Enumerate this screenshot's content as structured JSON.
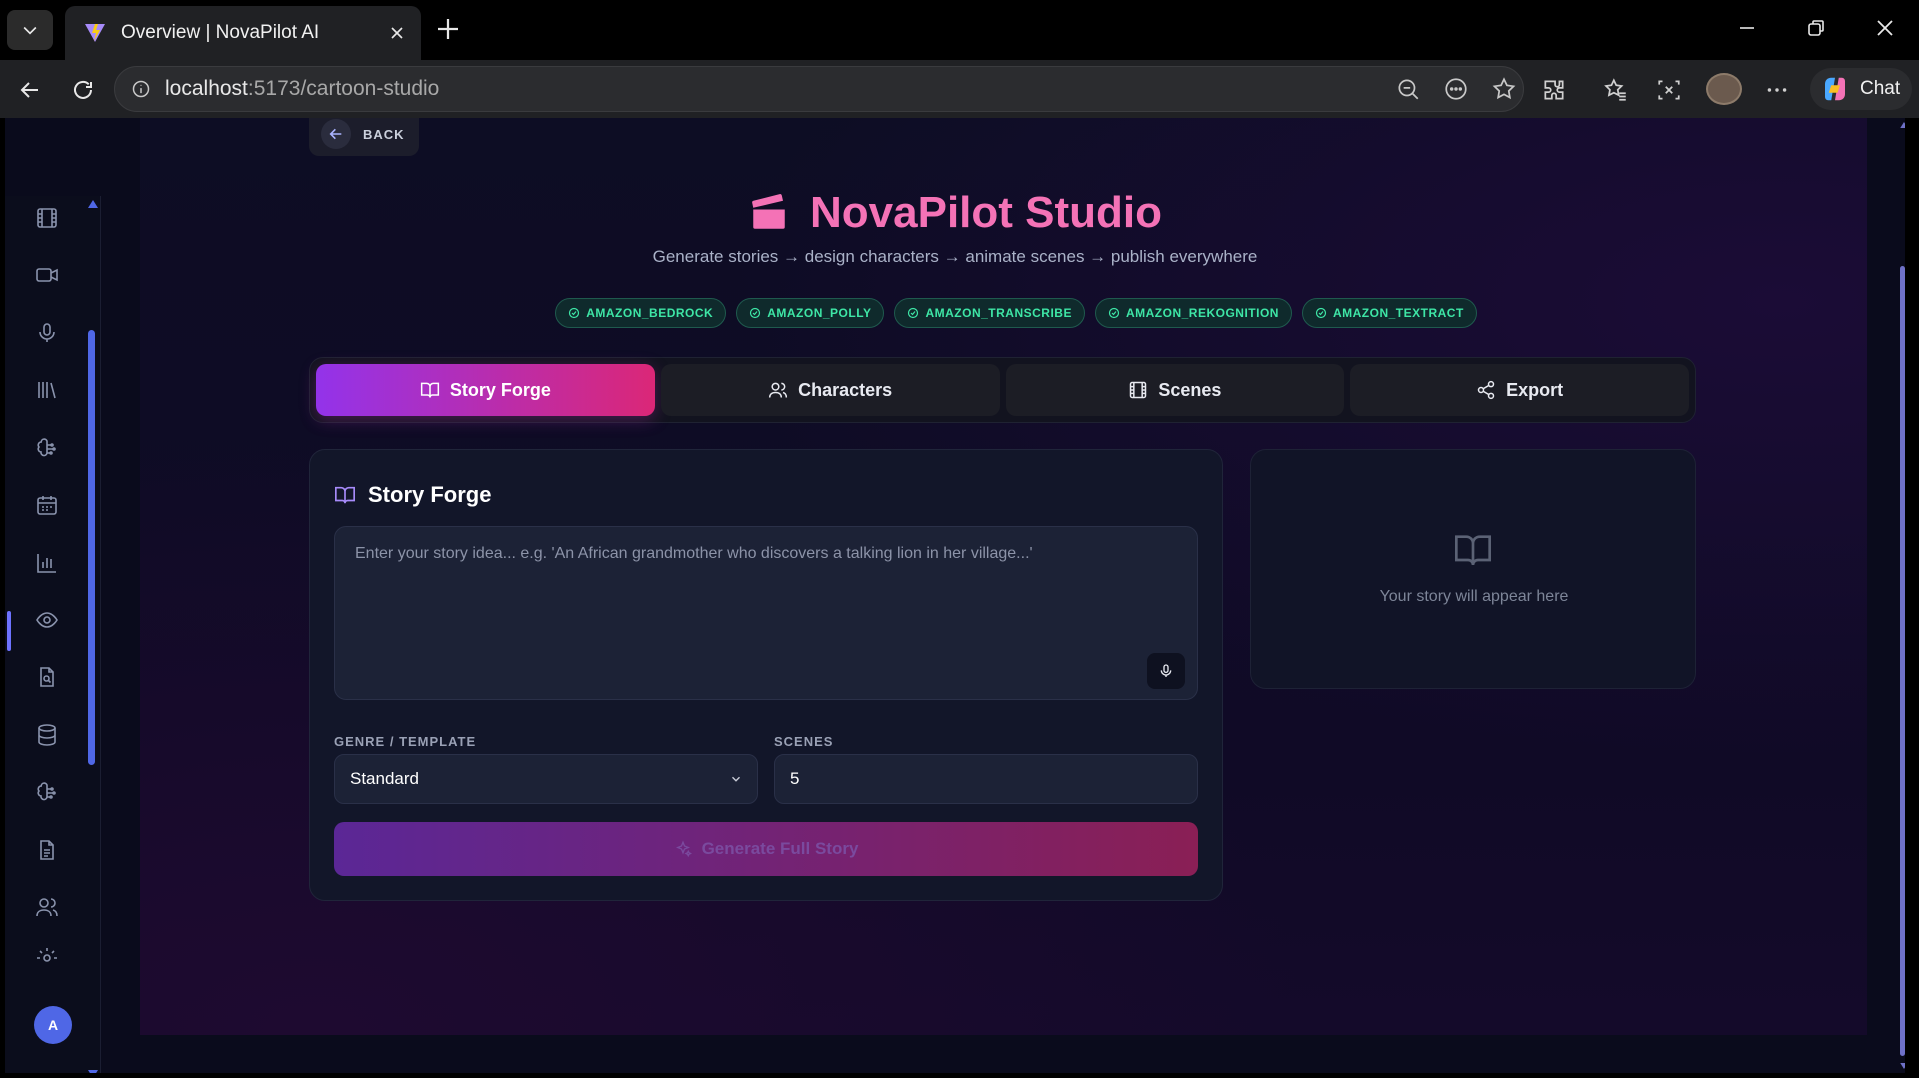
{
  "browser": {
    "tab_title": "Overview | NovaPilot AI",
    "url_host": "localhost",
    "url_path": ":5173/cartoon-studio",
    "chat_label": "Chat"
  },
  "back": {
    "label": "BACK"
  },
  "header": {
    "title": "NovaPilot Studio",
    "subtitle": "Generate stories → design characters → animate scenes → publish everywhere",
    "badges": [
      "AMAZON_BEDROCK",
      "AMAZON_POLLY",
      "AMAZON_TRANSCRIBE",
      "AMAZON_REKOGNITION",
      "AMAZON_TEXTRACT"
    ]
  },
  "tabs": [
    {
      "label": "Story Forge",
      "icon": "book-open-icon",
      "active": true
    },
    {
      "label": "Characters",
      "icon": "users-icon",
      "active": false
    },
    {
      "label": "Scenes",
      "icon": "film-icon",
      "active": false
    },
    {
      "label": "Export",
      "icon": "share-icon",
      "active": false
    }
  ],
  "story_forge": {
    "title": "Story Forge",
    "story_placeholder": "Enter your story idea... e.g. 'An African grandmother who discovers a talking lion in her village...'",
    "genre_label": "GENRE / TEMPLATE",
    "genre_value": "Standard",
    "scenes_label": "SCENES",
    "scenes_value": "5",
    "generate_label": "Generate Full Story"
  },
  "output": {
    "empty_text": "Your story will appear here"
  },
  "sidebar": {
    "icons": [
      "film-icon",
      "video-icon",
      "microphone-icon",
      "library-icon",
      "brain-icon",
      "calendar-icon",
      "bar-chart-icon",
      "eye-icon",
      "file-search-icon",
      "database-icon",
      "brain-icon",
      "document-icon",
      "users-icon",
      "settings-icon"
    ],
    "avatar_initial": "A"
  },
  "colors": {
    "accent_start": "#9333ea",
    "accent_end": "#db2777",
    "title_pink": "#f472b6",
    "badge_green": "#3ee6a6"
  }
}
